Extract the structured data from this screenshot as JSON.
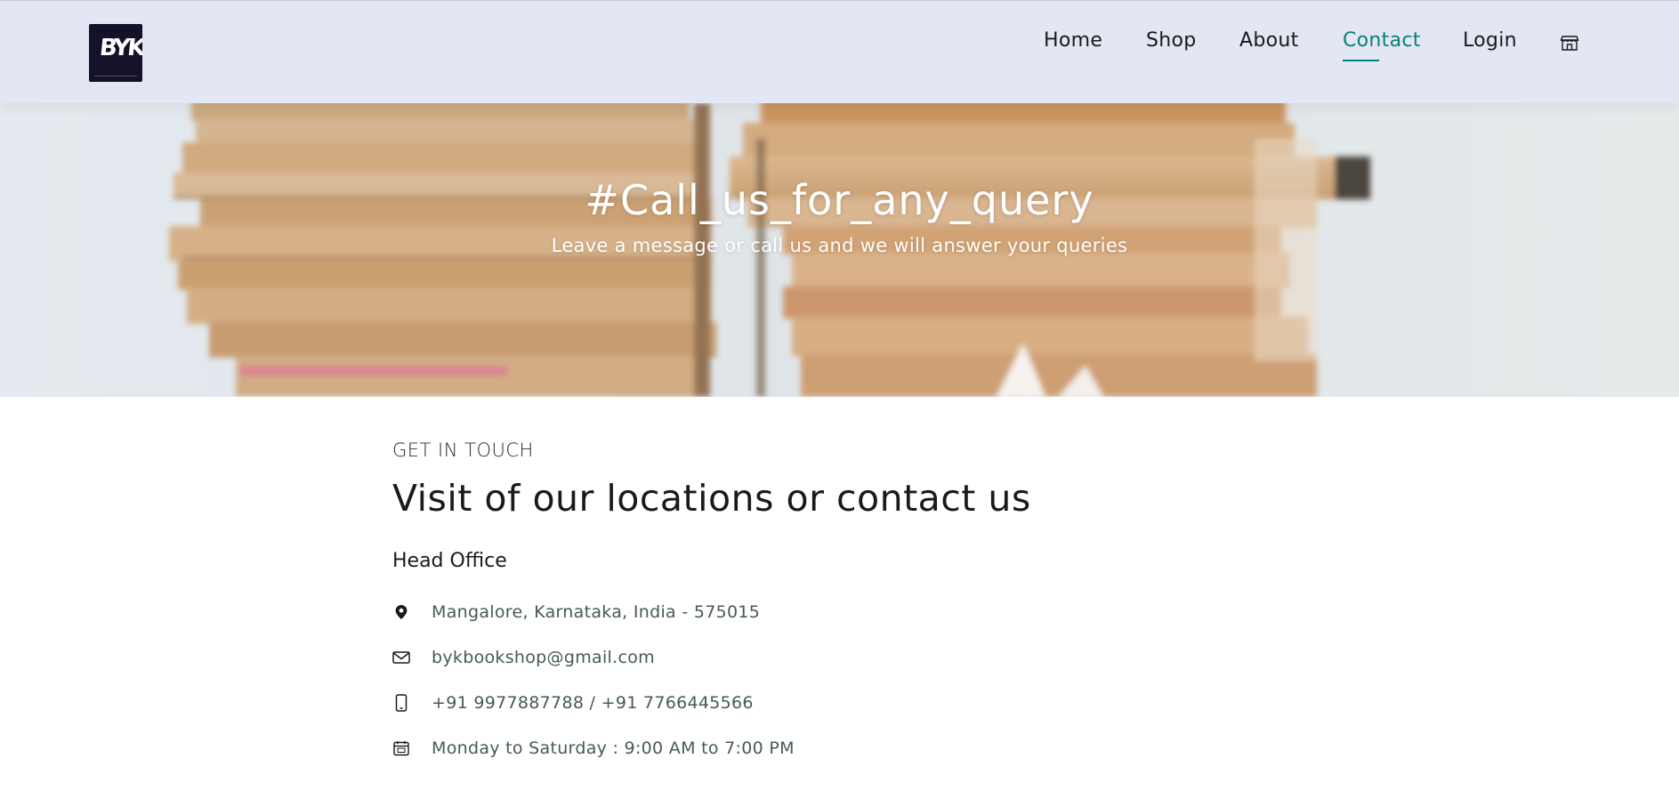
{
  "brand": {
    "logo_text": "BYK"
  },
  "nav": {
    "items": [
      {
        "label": "Home"
      },
      {
        "label": "Shop"
      },
      {
        "label": "About"
      },
      {
        "label": "Contact"
      },
      {
        "label": "Login"
      }
    ],
    "active": "Contact",
    "cart_icon": "storefront-bag-icon",
    "accent_color": "#088178"
  },
  "hero": {
    "title": "#Call_us_for_any_query",
    "subtitle": "Leave a message or call us and we will answer your queries",
    "background": "blurred stack of books"
  },
  "contact": {
    "eyebrow": "GET IN TOUCH",
    "heading": "Visit of our locations or contact us",
    "office_title": "Head Office",
    "items": [
      {
        "icon": "map-pin-icon",
        "text": "Mangalore, Karnataka, India - 575015"
      },
      {
        "icon": "envelope-icon",
        "text": "bykbookshop@gmail.com"
      },
      {
        "icon": "phone-icon",
        "text": "+91 9977887788 / +91 7766445566"
      },
      {
        "icon": "calendar-icon",
        "text": "Monday to Saturday : 9:00 AM to 7:00 PM"
      }
    ]
  },
  "colors": {
    "header_bg": "#e3e6f3",
    "text_muted": "#465b52",
    "logo_bg": "#14112b"
  }
}
